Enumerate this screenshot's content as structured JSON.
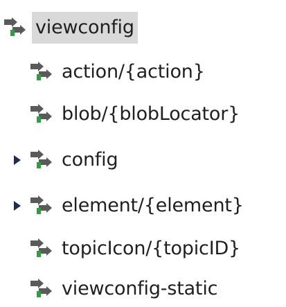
{
  "tree": {
    "root": {
      "label": "viewconfig",
      "icon": "resource-arrows-icon",
      "selected": true
    },
    "children": [
      {
        "label": "action/{action}",
        "icon": "resource-arrows-icon",
        "expandable": false
      },
      {
        "label": "blob/{blobLocator}",
        "icon": "resource-arrows-icon",
        "expandable": false
      },
      {
        "label": "config",
        "icon": "resource-arrows-icon",
        "expandable": true
      },
      {
        "label": "element/{element}",
        "icon": "resource-arrows-icon",
        "expandable": true
      },
      {
        "label": "topicIcon/{topicID}",
        "icon": "resource-arrows-icon",
        "expandable": false
      },
      {
        "label": "viewconfig-static",
        "icon": "resource-arrows-icon",
        "expandable": false
      }
    ]
  },
  "colors": {
    "selection_background": "#d9d9d9",
    "icon_gray": "#5a5a5a",
    "icon_green": "#2f9e3e",
    "expander": "#1f2d4d"
  }
}
